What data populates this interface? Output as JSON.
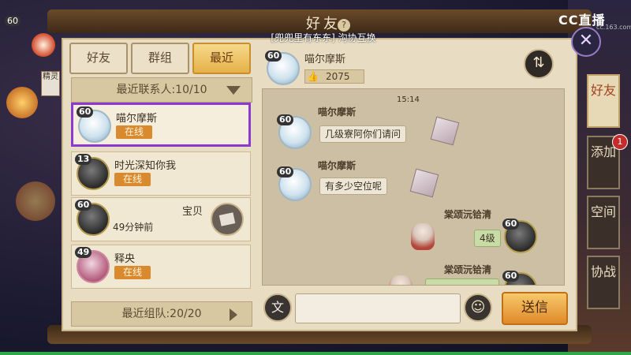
{
  "window": {
    "title": "好友",
    "subtitle": "[兜兜里有东东] 沟协互换",
    "watermark": "CC直播",
    "watermark_sub": "cc.163.com"
  },
  "tabs": [
    {
      "label": "好友",
      "active": false
    },
    {
      "label": "群组",
      "active": false
    },
    {
      "label": "最近",
      "active": true
    }
  ],
  "recent_contacts": {
    "label": "最近联系人:10/10"
  },
  "recent_teams": {
    "label": "最近组队:20/20"
  },
  "friends": [
    {
      "level": "60",
      "name": "喵尔摩斯",
      "status": "在线",
      "selected": true
    },
    {
      "level": "13",
      "name": "时光深知你我",
      "status": "在线"
    },
    {
      "level": "60",
      "name": "宝贝",
      "time": "49分钟前"
    },
    {
      "level": "49",
      "name": "释央",
      "status": "在线"
    }
  ],
  "profile": {
    "level": "60",
    "name": "喵尔摩斯",
    "likes": "2075"
  },
  "chat": {
    "time": "15:14",
    "messages": [
      {
        "level": "60",
        "name": "喵尔摩斯",
        "text": "几级寮阿你们请问"
      },
      {
        "level": "60",
        "name": "喵尔摩斯",
        "text": "有多少空位呢"
      },
      {
        "level": "60",
        "name": "棠颂沅铪清",
        "text": "4级"
      },
      {
        "level": "60",
        "name": "棠颂沅铪清",
        "text": ""
      }
    ]
  },
  "input": {
    "placeholder": ""
  },
  "buttons": {
    "send": "送信",
    "voice_text": "文",
    "swap": "⇅"
  },
  "side_tabs": [
    {
      "label": "好友",
      "active": true
    },
    {
      "label": "添加",
      "badge": "1"
    },
    {
      "label": "空间"
    },
    {
      "label": "协战"
    }
  ],
  "top_left": {
    "level": "60",
    "badge": "精灵"
  },
  "colors": {
    "active_tab": "#e5b14a",
    "status_online": "#d98a2e",
    "selected_border": "#8a3ad0",
    "send_button": "#e08a2a"
  }
}
